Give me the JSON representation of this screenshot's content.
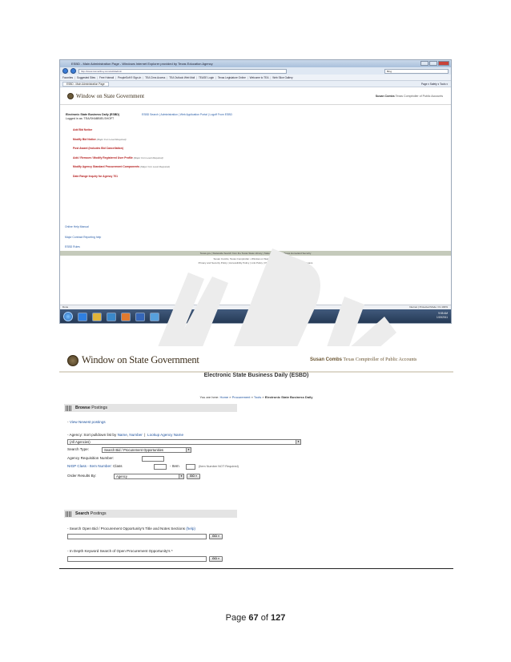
{
  "screenshot1": {
    "window_title": "ESBD - Main Administration Page - Windows Internet Explorer provided by Texas Education Agency",
    "address": "http://www.txsmartbuy.com/esbdadmin",
    "search_placeholder": "Bing",
    "favorites": [
      "Favorites",
      "Suggested Sites",
      "Free Hotmail",
      "PeopleSoft 9 Sign-In",
      "TEA Cims Access",
      "TEA Outlook Web Mail",
      "TEASE Login",
      "Texas Legislature Online",
      "Welcome to TEA",
      "Web Slice Gallery"
    ],
    "tab_label": "ESBD - Main Administration Page",
    "tools_text": "Page ▾  Safety ▾  Tools ▾",
    "header": {
      "logo_text": "Window on State Government",
      "comptroller_name": "Susan Combs",
      "comptroller_title": "Texas Comptroller of Public Accounts"
    },
    "esbd_title": "Electronic State Business Daily (ESBD)",
    "logged_in": "Logged in as: TEA/SHABBIELSHOFT",
    "links": "ESBD Search | Administration | Web Application Portal | Logoff From ESBD",
    "menu": [
      {
        "label": "Add Bid Notice",
        "note": ""
      },
      {
        "label": "Modify Bid Notice",
        "note": "(Major Con Level Required)"
      },
      {
        "label": "Post Award (Includes Bid Cancellation)",
        "note": ""
      },
      {
        "label": "Add / Remove / Modify Registered User Profile",
        "note": "(Major Con Level Required)"
      },
      {
        "label": "Modify Agency Standard Procurement Components",
        "note": "(Major Con Level Required)"
      },
      {
        "label": "Date Range Inquiry for Agency 701",
        "note": ""
      }
    ],
    "help_links": [
      "Online Help Manual",
      "Major Contract Reporting help",
      "ESBD Rules"
    ],
    "footer_band": "Texas.gov | Statewide Search from the Texas State Library | State Link Policy | Texas Homeland Security",
    "footer_line1": "Susan Combs, Texas Comptroller  •  Window on State Government  •  Contact Us",
    "footer_line2": "Privacy and Security Policy | Accessibility Policy | Link Policy | Public Information Act | Compact with Texans",
    "status_left": "Done",
    "status_right": "Internet | Protected Mode: On     100%",
    "clock_time": "9:55 AM",
    "clock_date": "1/19/2011"
  },
  "screenshot2": {
    "logo_text": "Window on State Government",
    "comptroller_name": "Susan Combs",
    "comptroller_title": "Texas Comptroller of Public Accounts",
    "page_title": "Electronic State Business Daily (ESBD)",
    "breadcrumb_prefix": "You are here: ",
    "breadcrumb_links": [
      "Home",
      "Procurement",
      "Tools"
    ],
    "breadcrumb_current": "Electronic State Business Daily",
    "browse_heading_bold": "Browse",
    "browse_heading_rest": " Postings",
    "view_newest": "View Newest postings",
    "agency_label": "- Agency: Sort pulldown list by ",
    "sort_name": "Name",
    "sort_number": "Number",
    "lookup_agency": "Lookup Agency Name",
    "agency_select": "(All Agencies)",
    "search_type_label": "Search Type:",
    "search_type_value": "Search Bid / Procurement Opportunities",
    "req_number_label": "Agency Requisition Number:",
    "nigp_label": "NIGP Class - Item Number:",
    "class_label": "Class",
    "item_label": "- Item",
    "item_note": "(Item Number NOT Required)",
    "order_label": "Order Results By:",
    "order_value": "Agency",
    "go_label": "GO »",
    "search_heading_bold": "Search",
    "search_heading_rest": " Postings",
    "search_line1": "- Search Open Bid / Procurement Opportunity's Title and Notes Sections",
    "help_link": "(help)",
    "search_line2": "- In Depth Keyword Search of Open Procurement Opportunity's *"
  },
  "footer": {
    "page_prefix": "Page ",
    "page_current": "67",
    "page_of": " of ",
    "page_total": "127"
  },
  "colors": {
    "link_blue": "#1a4f9c",
    "menu_red": "#b31b1b",
    "watermark": "#e9e9e9"
  }
}
